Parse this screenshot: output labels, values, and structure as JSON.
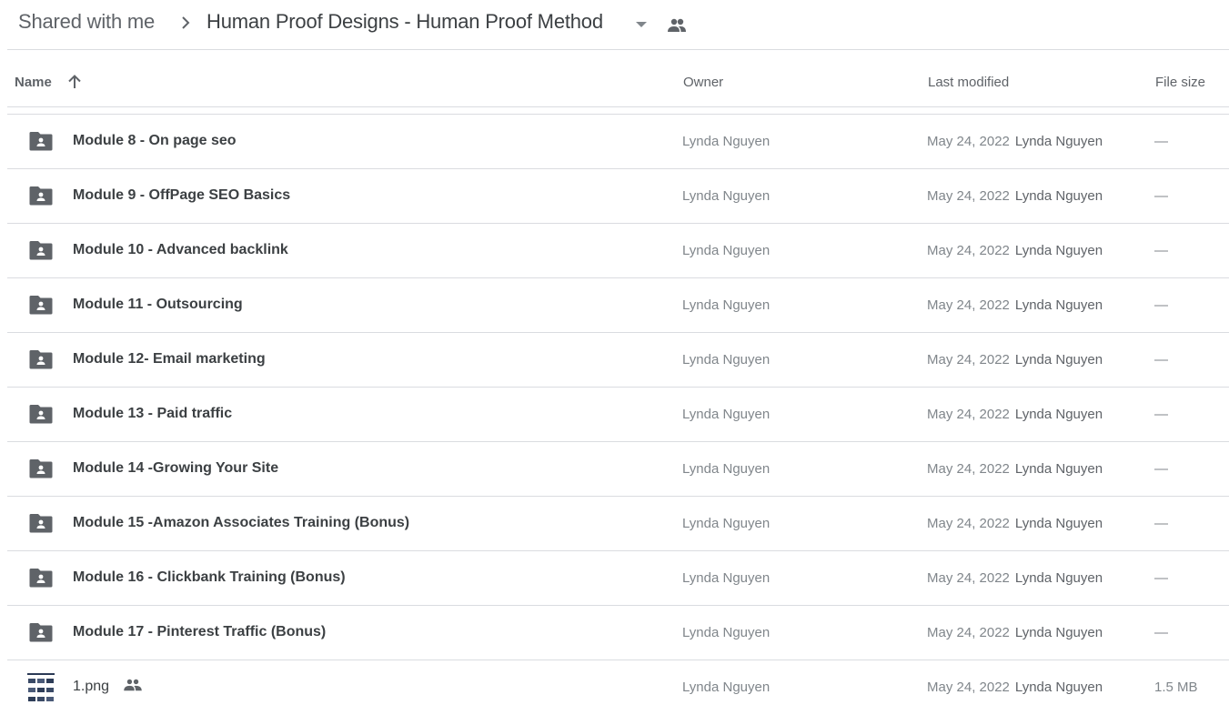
{
  "breadcrumb": {
    "root": "Shared with me",
    "separator_icon": "chevron-right-icon",
    "current": "Human Proof Designs - Human Proof Method",
    "dropdown_icon": "caret-down-icon",
    "shared_icon": "people-icon"
  },
  "columns": {
    "name": "Name",
    "sort_icon": "arrow-up-icon",
    "owner": "Owner",
    "last_modified": "Last modified",
    "file_size": "File size"
  },
  "colors": {
    "folder_icon": "#5f6368",
    "divider": "#dadce0",
    "text_primary": "#3c4043",
    "text_secondary": "#80868b"
  },
  "files": [
    {
      "name": "Module 8 - On page seo",
      "type": "shared-folder",
      "owner": "Lynda Nguyen",
      "modified_date": "May 24, 2022",
      "modified_by": "Lynda Nguyen",
      "size": "—"
    },
    {
      "name": "Module 9 - OffPage SEO Basics",
      "type": "shared-folder",
      "owner": "Lynda Nguyen",
      "modified_date": "May 24, 2022",
      "modified_by": "Lynda Nguyen",
      "size": "—"
    },
    {
      "name": "Module 10 - Advanced backlink",
      "type": "shared-folder",
      "owner": "Lynda Nguyen",
      "modified_date": "May 24, 2022",
      "modified_by": "Lynda Nguyen",
      "size": "—"
    },
    {
      "name": "Module 11 - Outsourcing",
      "type": "shared-folder",
      "owner": "Lynda Nguyen",
      "modified_date": "May 24, 2022",
      "modified_by": "Lynda Nguyen",
      "size": "—"
    },
    {
      "name": "Module 12- Email marketing",
      "type": "shared-folder",
      "owner": "Lynda Nguyen",
      "modified_date": "May 24, 2022",
      "modified_by": "Lynda Nguyen",
      "size": "—"
    },
    {
      "name": "Module 13 - Paid traffic",
      "type": "shared-folder",
      "owner": "Lynda Nguyen",
      "modified_date": "May 24, 2022",
      "modified_by": "Lynda Nguyen",
      "size": "—"
    },
    {
      "name": "Module 14 -Growing Your Site",
      "type": "shared-folder",
      "owner": "Lynda Nguyen",
      "modified_date": "May 24, 2022",
      "modified_by": "Lynda Nguyen",
      "size": "—"
    },
    {
      "name": "Module 15 -Amazon Associates Training (Bonus)",
      "type": "shared-folder",
      "owner": "Lynda Nguyen",
      "modified_date": "May 24, 2022",
      "modified_by": "Lynda Nguyen",
      "size": "—"
    },
    {
      "name": "Module 16 - Clickbank Training (Bonus)",
      "type": "shared-folder",
      "owner": "Lynda Nguyen",
      "modified_date": "May 24, 2022",
      "modified_by": "Lynda Nguyen",
      "size": "—"
    },
    {
      "name": "Module 17 - Pinterest Traffic (Bonus)",
      "type": "shared-folder",
      "owner": "Lynda Nguyen",
      "modified_date": "May 24, 2022",
      "modified_by": "Lynda Nguyen",
      "size": "—"
    },
    {
      "name": "1.png",
      "type": "image",
      "shared": true,
      "owner": "Lynda Nguyen",
      "modified_date": "May 24, 2022",
      "modified_by": "Lynda Nguyen",
      "size": "1.5 MB"
    }
  ]
}
